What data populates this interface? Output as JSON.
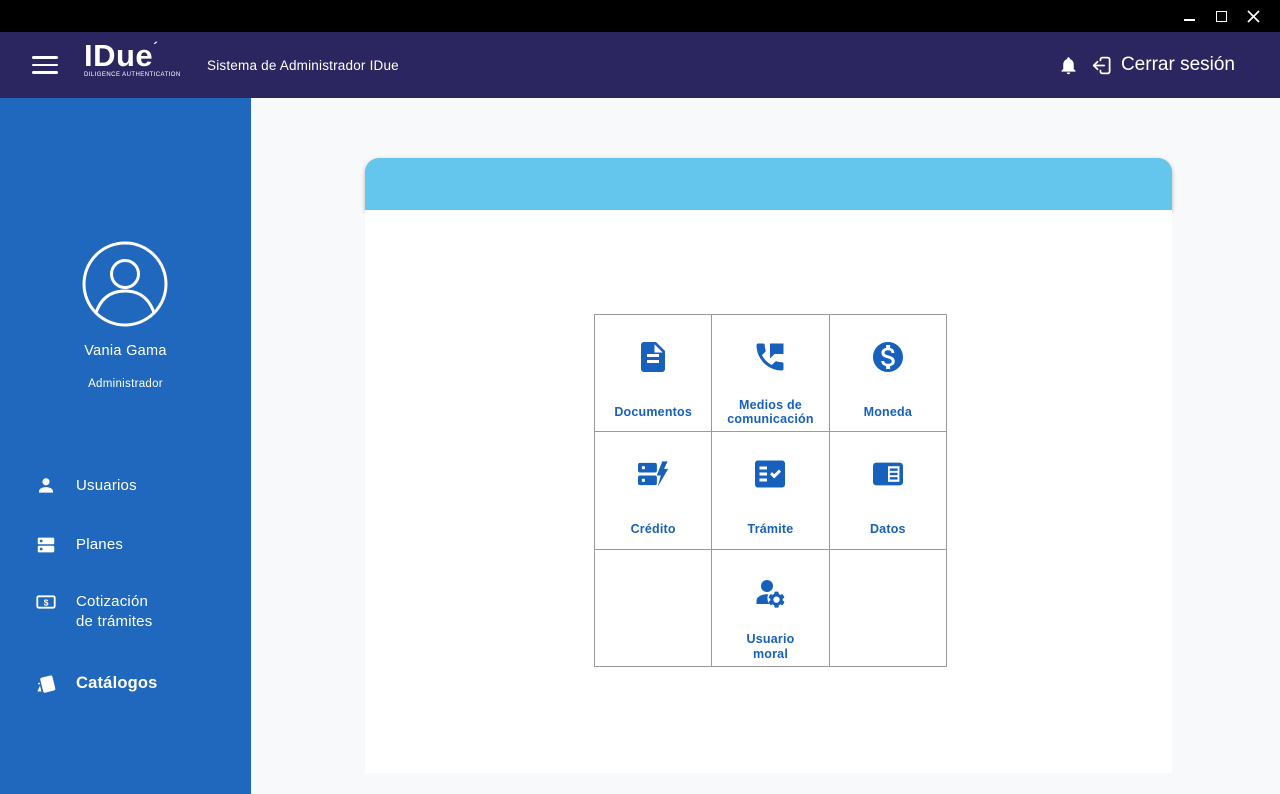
{
  "titlebar": {
    "controls": [
      {
        "name": "minimize"
      },
      {
        "name": "maximize"
      },
      {
        "name": "close"
      }
    ]
  },
  "header": {
    "logo": {
      "text": "IDue",
      "mark": "´",
      "subtext": "DILIGENCE AUTHENTICATION"
    },
    "title": "Sistema de Administrador IDue",
    "logout": {
      "label": "Cerrar sesión"
    }
  },
  "sidebar": {
    "user": {
      "name": "Vania Gama",
      "role": "Administrador"
    },
    "items": [
      {
        "label": "Usuarios",
        "icon": "person-icon",
        "active": false
      },
      {
        "label": "Planes",
        "icon": "plans-icon",
        "active": false
      },
      {
        "label": "Cotización\nde trámites",
        "icon": "quote-icon",
        "active": false
      },
      {
        "label": "Catálogos",
        "icon": "catalogs-icon",
        "active": true
      }
    ]
  },
  "main": {
    "catalog_grid": {
      "cells": [
        {
          "label": "Documentos",
          "icon": "document-icon"
        },
        {
          "label": "Medios de\ncomunicación",
          "icon": "phone-message-icon"
        },
        {
          "label": "Moneda",
          "icon": "currency-icon"
        },
        {
          "label": "Crédito",
          "icon": "credit-icon"
        },
        {
          "label": "Trámite",
          "icon": "checklist-icon"
        },
        {
          "label": "Datos",
          "icon": "data-card-icon"
        },
        {
          "label": "",
          "icon": ""
        },
        {
          "label": "Usuario\nmoral",
          "icon": "user-settings-icon"
        },
        {
          "label": "",
          "icon": ""
        }
      ]
    }
  },
  "icons": {
    "currency_symbol": "$"
  },
  "colors": {
    "titlebar": "#000000",
    "header": "#2B2660",
    "sidebar": "#2067BE",
    "banner": "#64C6EC",
    "accent_blue": "#1761BD",
    "content_bg": "#F8F9FA",
    "card": "#FFFFFF",
    "grid_border": "#9A9A9A"
  }
}
